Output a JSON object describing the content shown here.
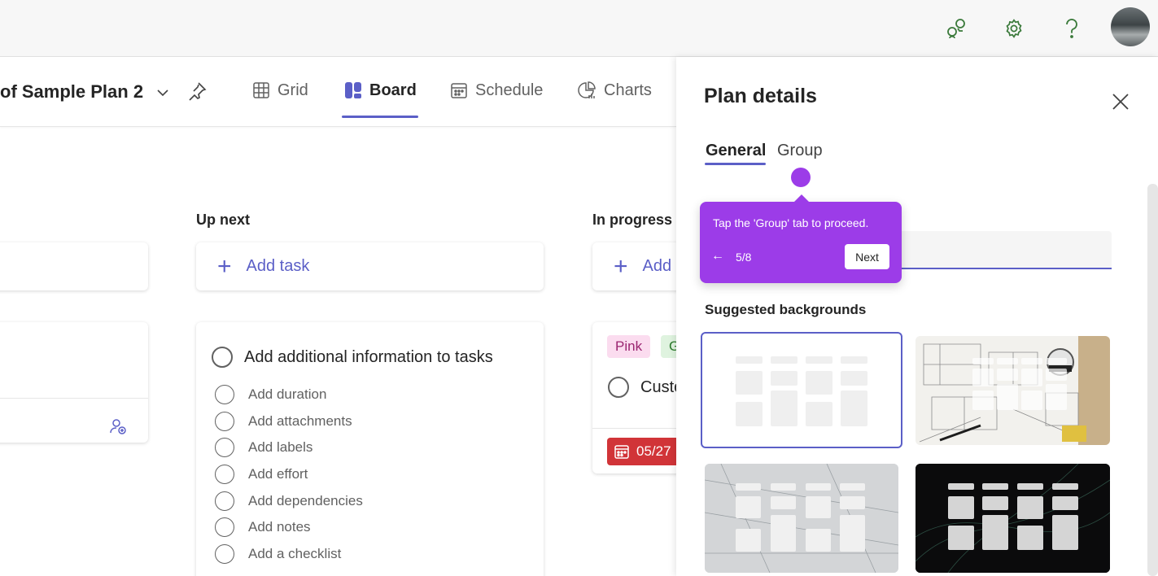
{
  "plan": {
    "title": "of Sample Plan 2",
    "views": [
      {
        "label": "Grid"
      },
      {
        "label": "Board"
      },
      {
        "label": "Schedule"
      },
      {
        "label": "Charts"
      }
    ],
    "active_view": "Board"
  },
  "board": {
    "columns": [
      {
        "title": "Up next",
        "add_task_label": "Add task"
      },
      {
        "title": "In progress",
        "add_task_label": "Add"
      }
    ],
    "up_next_card": {
      "title": "Add additional information to tasks",
      "subtasks": [
        "Add duration",
        "Add attachments",
        "Add labels",
        "Add effort",
        "Add dependencies",
        "Add notes",
        "Add a checklist"
      ]
    },
    "in_progress_card": {
      "labels": [
        "Pink",
        "G"
      ],
      "title": "Custo",
      "due_date": "05/27"
    }
  },
  "panel": {
    "title": "Plan details",
    "tabs": [
      "General",
      "Group"
    ],
    "active_tab": "General",
    "name_value": "",
    "suggested_title": "Suggested backgrounds"
  },
  "coachmark": {
    "text": "Tap the 'Group' tab to proceed.",
    "step": "5/8",
    "next_label": "Next"
  },
  "colors": {
    "accent": "#5b5fc7",
    "coachmark": "#9c3ce8",
    "due_red": "#d13438",
    "pink_label_bg": "#fbdcef",
    "green_label_bg": "#dff3df"
  },
  "icons": [
    "feedback-icon",
    "gear-icon",
    "help-icon",
    "grid-icon",
    "board-icon",
    "schedule-icon",
    "charts-icon",
    "pin-icon",
    "close-icon",
    "calendar-icon",
    "assign-icon"
  ]
}
